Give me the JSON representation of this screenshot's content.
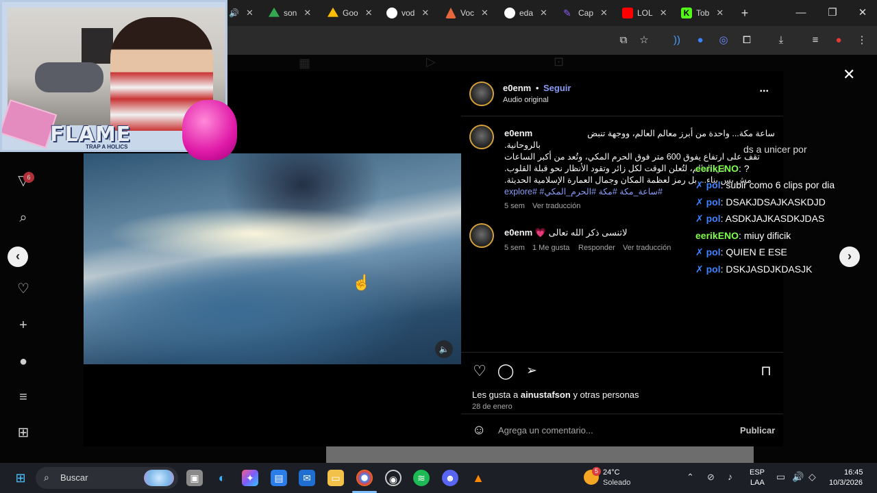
{
  "browser": {
    "tabs": [
      {
        "label": "son",
        "color": "#34a853"
      },
      {
        "label": "Goo",
        "color": "#fbbc04"
      },
      {
        "label": "vod",
        "color": "#ffffff"
      },
      {
        "label": "Voc",
        "color": "#e8663d"
      },
      {
        "label": "eda",
        "color": "#ffffff"
      },
      {
        "label": "Cap",
        "color": "#8b5cf6"
      },
      {
        "label": "LOL",
        "color": "#ff0000"
      },
      {
        "label": "Tob",
        "color": "#53fc18"
      }
    ],
    "new_tab": "+",
    "window_buttons": {
      "minimize": "—",
      "restore": "❐",
      "close": "✕"
    }
  },
  "post": {
    "author": "e0enm",
    "follow_label": "Seguir",
    "separator": "•",
    "audio": "Audio original",
    "caption_lines": [
      "ساعة مكة... واحدة من أبرز معالم العالم، ووجهة تنبض",
      "بالروحانية.",
      "تقف على ارتفاع يفوق 600 متر فوق الحرم المكي، وتُعد من أكبر الساعات",
      "في العالم، لتُعلن الوقت لكل زائر وتقود الأنظار نحو قبلة القلوب.",
      "مش بس بناء... بل رمز لعظمة المكان وجمال العمارة الإسلامية الحديثة."
    ],
    "hashtags": "explore# #ساعة_مكة #مكة #الحرم_المكي#",
    "caption_time": "5 sem",
    "caption_translate": "Ver traducción",
    "comment": {
      "author": "e0enm",
      "heart": "💗",
      "text": "لاتنسى ذكر الله تعالى",
      "time": "5 sem",
      "likes": "1 Me gusta",
      "reply": "Responder",
      "translate": "Ver traducción"
    },
    "likes_prefix": "Les gusta a",
    "likes_user": "ainustafson",
    "likes_suffix": "y otras personas",
    "date": "28 de enero",
    "comment_placeholder": "Agrega un comentario...",
    "publish": "Publicar",
    "more": "•••",
    "close": "✕"
  },
  "stream": {
    "banner_title": "FLAME",
    "banner_sub": "TRAP A HOLICS",
    "chat_top_fragment": "ds a unicer por",
    "chat": [
      {
        "user": "eerikENO",
        "text": ": ?",
        "badge": false,
        "color": "#7dff4a"
      },
      {
        "user": "pol",
        "text": ": subir como 6 clips por dia",
        "badge": true,
        "color": "#3a82ff"
      },
      {
        "user": "pol",
        "text": ": DSAKJDSAJKASKDJD",
        "badge": true,
        "color": "#3a82ff"
      },
      {
        "user": "pol",
        "text": ": ASDKJAJKASDKJDAS",
        "badge": true,
        "color": "#3a82ff"
      },
      {
        "user": "eerikENO",
        "text": ": miuy dificik",
        "badge": false,
        "color": "#7dff4a"
      },
      {
        "user": "pol",
        "text": ": QUIEN E ESE",
        "badge": true,
        "color": "#3a82ff"
      },
      {
        "user": "pol",
        "text": ": DSKJASDJKDASJK",
        "badge": true,
        "color": "#3a82ff"
      }
    ]
  },
  "taskbar": {
    "search_label": "Buscar",
    "weather_temp": "24°C",
    "weather_desc": "Soleado",
    "weather_badge": "5",
    "lang_top": "ESP",
    "lang_bottom": "LAA",
    "time": "16:45",
    "date": "10/3/2026"
  }
}
